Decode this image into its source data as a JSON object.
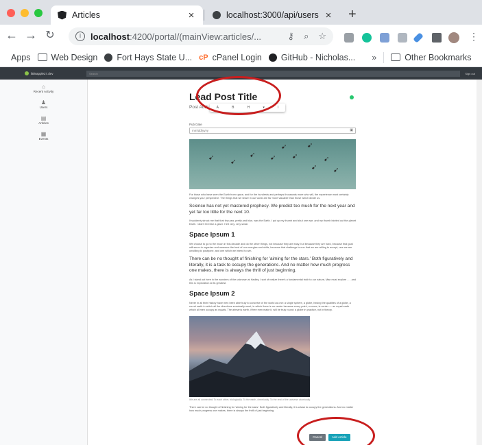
{
  "browser": {
    "tabs": [
      {
        "label": "Articles",
        "icon": "angular-icon"
      },
      {
        "label": "localhost:3000/api/users",
        "icon": "globe-icon"
      }
    ],
    "new_tab_glyph": "+",
    "close_glyph": "×",
    "url": {
      "host": "localhost",
      "rest": ":4200/portal/(mainView:articles/..."
    },
    "bookmarks": [
      {
        "label": "Apps",
        "icon": "apps-grid-icon"
      },
      {
        "label": "Web Design",
        "icon": "folder-icon"
      },
      {
        "label": "Fort Hays State U...",
        "icon": "globe-icon"
      },
      {
        "label": "cPanel Login",
        "icon": "cpanel-icon"
      },
      {
        "label": "GitHub - Nicholas...",
        "icon": "github-icon"
      },
      {
        "label": "Other Bookmarks",
        "icon": "folder-icon"
      }
    ],
    "bookmarks_overflow": "»"
  },
  "appbar": {
    "brand": "littleapple27.dev",
    "search_placeholder": "Search",
    "signout": "Sign out"
  },
  "sidebar": {
    "items": [
      {
        "label": "Recent Activity",
        "icon": "home-icon"
      },
      {
        "label": "Users",
        "icon": "user-icon"
      },
      {
        "label": "Articles",
        "icon": "articles-icon"
      },
      {
        "label": "Events",
        "icon": "calendar-icon"
      }
    ]
  },
  "article": {
    "title": "Lead Post Title",
    "author_placeholder": "Post Auth",
    "toolbar": [
      "A",
      "B",
      "H",
      "▾",
      "I"
    ],
    "pub_date_label": "Pub Date",
    "pub_date_placeholder": "mm/dd/yyyy",
    "p1": "For those who have seen the Earth from space, and for the hundreds and perhaps thousands more who will, the experience most certainly changes your perspective. The things that we share in our world are far more valuable than those which divide us.",
    "q1": "Science has not yet mastered prophecy. We predict too much for the next year and yet far too little for the next 10.",
    "p2": "It suddenly struck me that that tiny pea, pretty and blue, was the Earth. I put up my thumb and shut one eye, and my thumb blotted out the planet Earth. I didn't feel like a giant. I felt very, very small.",
    "h1": "Space Ipsum 1",
    "p3": "We choose to go to the moon in this decade and do the other things, not because they are easy, but because they are hard, because that goal will serve to organize and measure the best of our energies and skills, because that challenge is one that we are willing to accept, one we are unwilling to postpone, and one which we intend to win.",
    "q2": "There can be no thought of finishing for 'aiming for the stars.' Both figuratively and literally, it is a task to occupy the generations. And no matter how much progress one makes, there is always the thrill of just beginning.",
    "p4": "As I stand out here in the wonders of the unknown at Hadley, I sort of realize there's a fundamental truth to our nature, Man must explore . . . and this is exploration at its greatest.",
    "h2": "Space Ipsum 2",
    "p5": "Never in all their history have men been able truly to conceive of the world as one: a single sphere, a globe, having the qualities of a globe, a round earth in which all the directions eventually meet, in which there is no center because every point, or none, is center — an equal earth which all men occupy as equals. The airman's earth, if free men make it, will be truly round: a globe in practice, not in theory.",
    "caption": "We are all connected; To each other, biologically. To the earth, chemically. To the rest of the universe atomically.",
    "p6": "There can be no thought of finishing for 'aiming for the stars.' Both figuratively and literally, it is a task to occupy the generations. And no matter how much progress one makes, there is always the thrill of just beginning."
  },
  "actions": {
    "cancel": "Cancel",
    "add": "Add Article"
  },
  "colors": {
    "annotation_ring": "#c81e1e",
    "add_button": "#17a2b8",
    "cancel_button": "#6c757d",
    "status_dot": "#28c76f"
  }
}
